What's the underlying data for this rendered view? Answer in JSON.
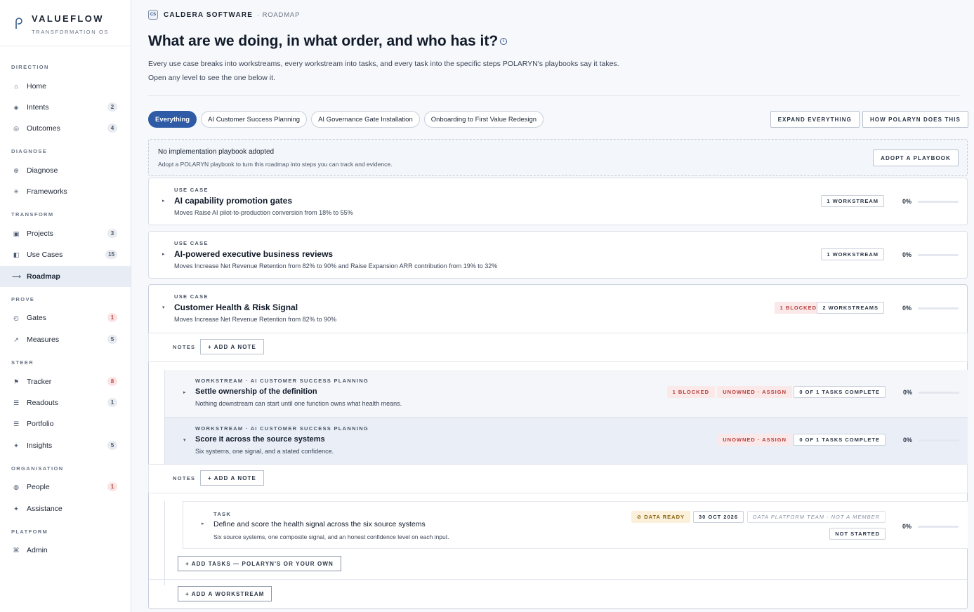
{
  "brand": {
    "name": "VALUEFLOW",
    "subtitle": "TRANSFORMATION OS"
  },
  "sidebar": {
    "sections": {
      "direction": "DIRECTION",
      "diagnose": "DIAGNOSE",
      "transform": "TRANSFORM",
      "prove": "PROVE",
      "steer": "STEER",
      "organisation": "ORGANISATION",
      "platform": "PLATFORM"
    },
    "items": {
      "home": {
        "label": "Home"
      },
      "intents": {
        "label": "Intents",
        "badge": "2"
      },
      "outcomes": {
        "label": "Outcomes",
        "badge": "4"
      },
      "diagnose": {
        "label": "Diagnose"
      },
      "frameworks": {
        "label": "Frameworks"
      },
      "projects": {
        "label": "Projects",
        "badge": "3"
      },
      "use_cases": {
        "label": "Use Cases",
        "badge": "15"
      },
      "roadmap": {
        "label": "Roadmap"
      },
      "gates": {
        "label": "Gates",
        "badge": "1"
      },
      "measures": {
        "label": "Measures",
        "badge": "5"
      },
      "tracker": {
        "label": "Tracker",
        "badge": "8"
      },
      "readouts": {
        "label": "Readouts",
        "badge": "1"
      },
      "portfolio": {
        "label": "Portfolio"
      },
      "insights": {
        "label": "Insights",
        "badge": "5"
      },
      "people": {
        "label": "People",
        "badge": "1"
      },
      "assistance": {
        "label": "Assistance"
      },
      "admin": {
        "label": "Admin"
      }
    }
  },
  "header": {
    "company_initials": "CS",
    "company_name": "CALDERA SOFTWARE",
    "breadcrumb": "· ROADMAP",
    "title": "What are we doing, in what order, and who has it?",
    "description": "Every use case breaks into workstreams, every workstream into tasks, and every task into the specific steps POLARYN's playbooks say it takes. Open any level to see the one below it."
  },
  "filters": [
    "Everything",
    "AI Customer Success Planning",
    "AI Governance Gate Installation",
    "Onboarding to First Value Redesign"
  ],
  "actions": {
    "expand": "EXPAND EVERYTHING",
    "how": "HOW POLARYN DOES THIS"
  },
  "playbook": {
    "title": "No implementation playbook adopted",
    "subtitle": "Adopt a POLARYN playbook to turn this roadmap into steps you can track and evidence.",
    "button": "ADOPT A PLAYBOOK"
  },
  "use_cases": [
    {
      "label": "USE CASE",
      "title": "AI capability promotion gates",
      "subtitle": "Moves Raise AI pilot-to-production conversion from 18% to 55%",
      "workstreams_tag": "1 WORKSTREAM",
      "percent": "0%",
      "progress": 0
    },
    {
      "label": "USE CASE",
      "title": "AI-powered executive business reviews",
      "subtitle": "Moves Increase Net Revenue Retention from 82% to 90% and Raise Expansion ARR contribution from 19% to 32%",
      "workstreams_tag": "1 WORKSTREAM",
      "percent": "0%",
      "progress": 0
    },
    {
      "label": "USE CASE",
      "title": "Customer Health & Risk Signal",
      "subtitle": "Moves Increase Net Revenue Retention from 82% to 90%",
      "blocked_tag": "1 BLOCKED",
      "workstreams_tag": "2 WORKSTREAMS",
      "percent": "0%",
      "progress": 0
    }
  ],
  "notes": {
    "label": "NOTES",
    "button": "+ ADD A NOTE"
  },
  "workstreams": [
    {
      "label": "WORKSTREAM · AI CUSTOMER SUCCESS PLANNING",
      "title": "Settle ownership of the definition",
      "subtitle": "Nothing downstream can start until one function owns what health means.",
      "blocked_tag": "1 BLOCKED",
      "owner_tag": "UNOWNED · ASSIGN",
      "tasks_tag": "0 OF 1 TASKS COMPLETE",
      "percent": "0%",
      "progress": 0
    },
    {
      "label": "WORKSTREAM · AI CUSTOMER SUCCESS PLANNING",
      "title": "Score it across the source systems",
      "subtitle": "Six systems, one signal, and a stated confidence.",
      "owner_tag": "UNOWNED · ASSIGN",
      "tasks_tag": "0 OF 1 TASKS COMPLETE",
      "percent": "0%",
      "progress": 0
    }
  ],
  "task": {
    "label": "TASK",
    "title": "Define and score the health signal across the six source systems",
    "subtitle": "Six source systems, one composite signal, and an honest confidence level on each input.",
    "ready_tag": "DATA READY",
    "date_tag": "30 OCT 2026",
    "team_tag": "DATA PLATFORM TEAM · NOT A MEMBER",
    "status_tag": "NOT STARTED",
    "percent": "0%",
    "progress": 0
  },
  "add_tasks": "+ ADD TASKS — POLARYN'S OR YOUR OWN",
  "add_workstream": "+ ADD A WORKSTREAM"
}
